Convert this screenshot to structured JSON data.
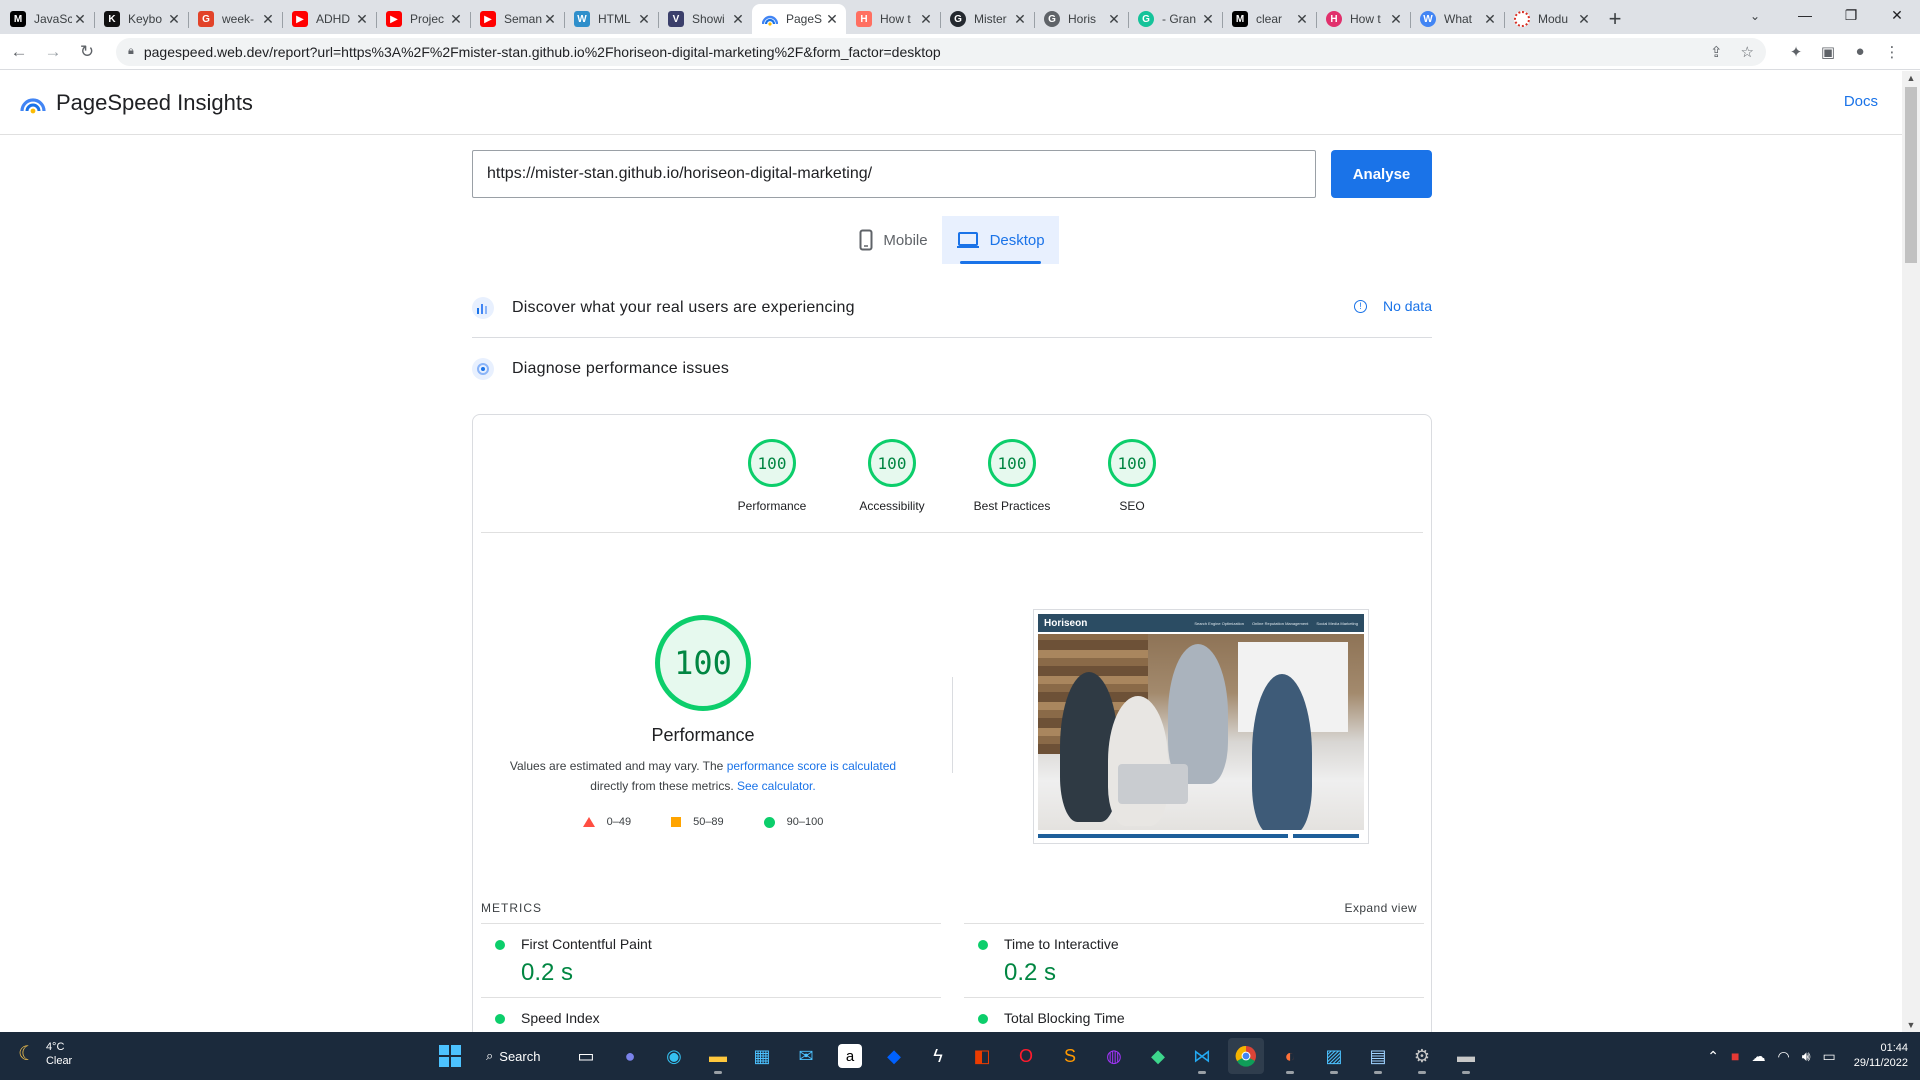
{
  "browser": {
    "tabs": [
      {
        "title": "JavaSc",
        "fav_char": "M",
        "fav_color": "#000000"
      },
      {
        "title": "Keybo",
        "fav_char": "K",
        "fav_color": "#111111"
      },
      {
        "title": "week-",
        "fav_char": "G",
        "fav_color": "#e24329"
      },
      {
        "title": "ADHD",
        "fav_char": "▶",
        "fav_color": "#ff0000"
      },
      {
        "title": "Projec",
        "fav_char": "▶",
        "fav_color": "#ff0000"
      },
      {
        "title": "Seman",
        "fav_char": "▶",
        "fav_color": "#ff0000"
      },
      {
        "title": "HTML",
        "fav_char": "W",
        "fav_color": "#2f8fcb"
      },
      {
        "title": "Showi",
        "fav_char": "V",
        "fav_color": "#3b3f6b"
      },
      {
        "title": "PageS",
        "fav_char": "P",
        "fav_color": "#1a73e8",
        "active": true
      },
      {
        "title": "How t",
        "fav_char": "H",
        "fav_color": "#ff6f61"
      },
      {
        "title": "Mister",
        "fav_char": "G",
        "fav_color": "#24292f"
      },
      {
        "title": "Horis",
        "fav_char": "G",
        "fav_color": "#5f6368"
      },
      {
        "title": "- Gran",
        "fav_char": "G",
        "fav_color": "#15c39a"
      },
      {
        "title": "clear",
        "fav_char": "M",
        "fav_color": "#000000"
      },
      {
        "title": "How t",
        "fav_char": "H",
        "fav_color": "#e1306c"
      },
      {
        "title": "What",
        "fav_char": "W",
        "fav_color": "#4285f4"
      },
      {
        "title": "Modu",
        "fav_char": "O",
        "fav_color": "#d93025"
      }
    ],
    "url": "pagespeed.web.dev/report?url=https%3A%2F%2Fmister-stan.github.io%2Fhoriseon-digital-marketing%2F&form_factor=desktop"
  },
  "header": {
    "title": "PageSpeed Insights",
    "docs_label": "Docs"
  },
  "form": {
    "url_value": "https://mister-stan.github.io/horiseon-digital-marketing/",
    "analyse_label": "Analyse"
  },
  "device_tabs": {
    "mobile_label": "Mobile",
    "desktop_label": "Desktop",
    "selected": "Desktop"
  },
  "crux": {
    "title": "Discover what your real users are experiencing",
    "no_data_label": "No data"
  },
  "diagnose": {
    "title": "Diagnose performance issues"
  },
  "scores": [
    {
      "label": "Performance",
      "value": "100"
    },
    {
      "label": "Accessibility",
      "value": "100"
    },
    {
      "label": "Best Practices",
      "value": "100"
    },
    {
      "label": "SEO",
      "value": "100"
    }
  ],
  "performance": {
    "score": "100",
    "title": "Performance",
    "note_part1": "Values are estimated and may vary. The",
    "note_link1": "performance score is calculated",
    "note_part2": "directly from these metrics.",
    "note_link2": "See calculator.",
    "legend": [
      "0–49",
      "50–89",
      "90–100"
    ]
  },
  "screenshot": {
    "brand": "Horiseon",
    "links": [
      "Search Engine Optimization",
      "Online Reputation Management",
      "Social Media Marketing"
    ]
  },
  "metrics": {
    "heading": "METRICS",
    "expand_label": "Expand view",
    "items": [
      {
        "name": "First Contentful Paint",
        "value": "0.2 s"
      },
      {
        "name": "Time to Interactive",
        "value": "0.2 s"
      },
      {
        "name": "Speed Index",
        "value": ""
      },
      {
        "name": "Total Blocking Time",
        "value": ""
      }
    ]
  },
  "taskbar": {
    "temperature": "4°C",
    "condition": "Clear",
    "search_label": "Search",
    "time": "01:44",
    "date": "29/11/2022"
  },
  "colors": {
    "accent": "#1a73e8",
    "pass": "#0cce6b",
    "pass_text": "#018642",
    "average": "#ffa400",
    "fail": "#ff4e42"
  }
}
